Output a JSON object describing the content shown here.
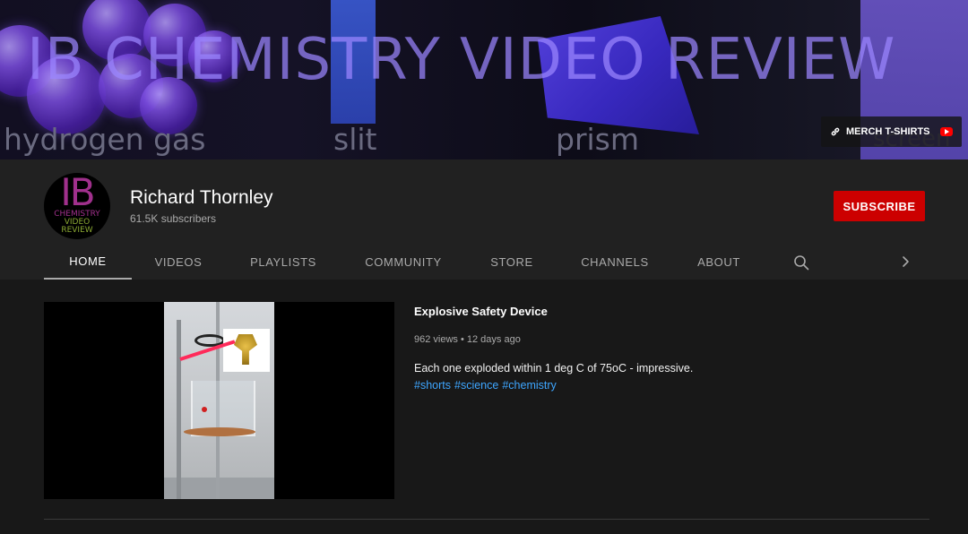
{
  "banner": {
    "title": "IB CHEMISTRY VIDEO REVIEW",
    "labels": [
      "hydrogen gas",
      "slit",
      "prism",
      "screen"
    ],
    "merch_label": "MERCH T-SHIRTS"
  },
  "avatar": {
    "big": "IB",
    "line1": "CHEMISTRY",
    "line2": "VIDEO",
    "line3": "REVIEW"
  },
  "channel": {
    "name": "Richard Thornley",
    "subscribers": "61.5K subscribers",
    "subscribe_label": "SUBSCRIBE"
  },
  "tabs": [
    "HOME",
    "VIDEOS",
    "PLAYLISTS",
    "COMMUNITY",
    "STORE",
    "CHANNELS",
    "ABOUT"
  ],
  "featured": {
    "title": "Explosive Safety Device",
    "meta": "962 views • 12 days ago",
    "description": "Each one exploded within 1 deg C of 75oC - impressive.",
    "tags": [
      "#shorts",
      "#science",
      "#chemistry"
    ]
  },
  "colors": {
    "subscribe": "#cc0000",
    "link": "#3ea6ff",
    "header_bg": "#212121",
    "page_bg": "#181818"
  }
}
